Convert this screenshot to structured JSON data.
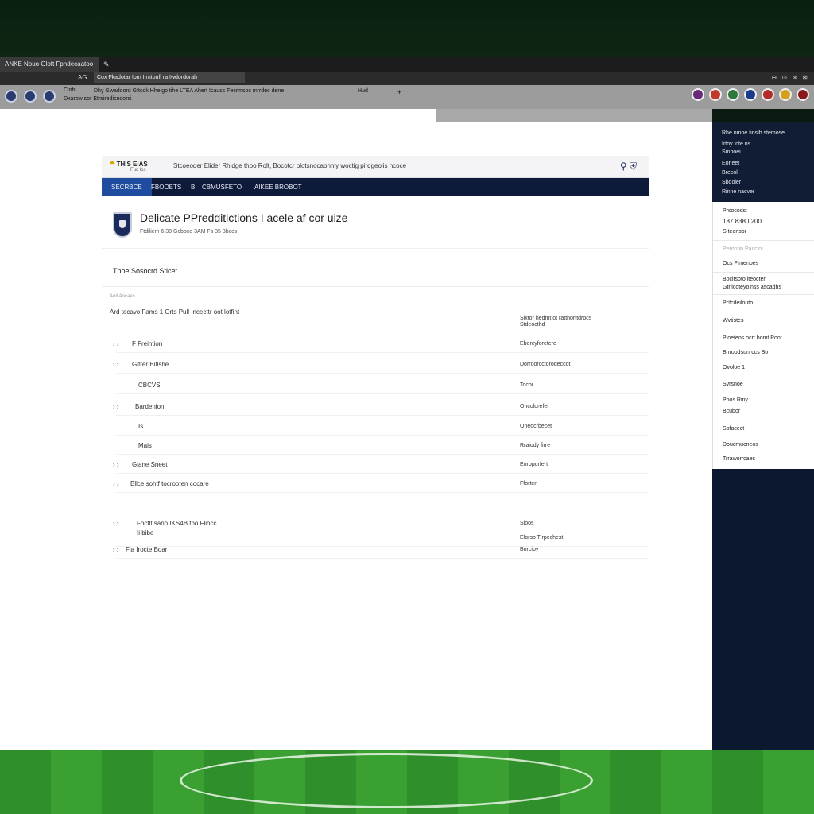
{
  "browser": {
    "tab_title": "ANKE Nouo Gloft Fpndecaatoo",
    "address_label": "AG",
    "url": "Cox Fkadotar Iom Irmtonfl ra Iwdordorah",
    "toolbar_right": "⊖ ⊙ ⊗ ⊠"
  },
  "bookmarks": {
    "line1": "Cinb",
    "line2": "Dxarow sor Etrsiredicnoorsi",
    "main": "Dhy Gwadoord Gftcok Hhelgo tihe LTEA Ahert Icauss Fecrmsoc mrrdec dene",
    "q": "Hud",
    "plus": "+"
  },
  "site": {
    "logo": "THIS EIAS",
    "logo_sub": "Fuc los",
    "header_text": "Stcoeoder Elider Rhidge thoo Rolt, Bocotcr plotsnocaonnly woctig pirdgeolis ncoce",
    "nav": [
      "SECRBCE",
      "FBOOETS",
      "B",
      "CBMUSFETO",
      "AIKEE BROBOT"
    ],
    "title": "Delicate PPredditictions I acele af cor uize",
    "subtitle": "Ftdiliem 6:38 Gcboce 3AM Fs 35 3bccs",
    "section": "Thoe Sosocrd Sticet",
    "small_label": "Aoit Aocaes",
    "col_left": "Ard tecavo Fams 1 Orts Pull Incecttr oot lotfint",
    "col_right": "Sixtor hedmt ot ratthorttdrocs Stdeocthd"
  },
  "rows": [
    {
      "chev": "› ›",
      "label": "F Freintion",
      "value": "Ebercyforetere"
    },
    {
      "chev": "› ›",
      "label": "Gifrer Bitlshe",
      "value": "Dorroorcctorodeccot"
    },
    {
      "chev": "",
      "label": "CBCVS",
      "value": "Tocor"
    },
    {
      "chev": "› ›",
      "label": "Bardenion",
      "value": "Oncolorefet"
    },
    {
      "chev": "",
      "label": "Is",
      "value": "Oneocrbecet"
    },
    {
      "chev": "",
      "label": "Mais",
      "value": "Rraiody firre"
    },
    {
      "chev": "› ›",
      "label": "Giane Sneet",
      "value": "Eoroporfert"
    },
    {
      "chev": "› ›",
      "label": "Bllce sohtf tocrooten cocare",
      "value": "Fforten"
    },
    {
      "chev": "› ›",
      "label": "Foctlt sano IKS4B tho Fliocc",
      "value": "Sioos"
    },
    {
      "chev": "",
      "label": "Ii bibe",
      "value": "Elorso Tlrpechest"
    },
    {
      "chev": "› ›",
      "label": "Fla Irocte Boar",
      "value": "Borcipy"
    }
  ],
  "sidebar": {
    "top_items": [
      "Rhe nmoe tinslh stemose",
      "Irtoy inte ns",
      "Smpoei",
      "Eoneet",
      "Brecol",
      "Sbdoler",
      "Rinne nacver"
    ],
    "price_label": "Prsocods:",
    "price": "187 8380 200.",
    "price_sub": "S teonsor",
    "faint": "Peroritin Paccint",
    "items": [
      "Ocs Fimenoes",
      "Bocitsoto lteocter",
      "Gtrlicoteyolnss ascadhs",
      "Pcfcdeilouto",
      "Wvtistes",
      "Pioeteos ocrt bomt Poot",
      "Bhrobdsunrccs Bo",
      "Ovoloe 1",
      "Svrsnoe",
      "Ppos Riny",
      "Bcubor",
      "Sofacect",
      "Doucmucneos",
      "Trraworrcaes"
    ]
  },
  "colors": {
    "nav_bg": "#0d1a3a",
    "nav_active": "#1f4c9e",
    "sidebar_dark": "#111d35",
    "pitch": "#3aa032"
  }
}
